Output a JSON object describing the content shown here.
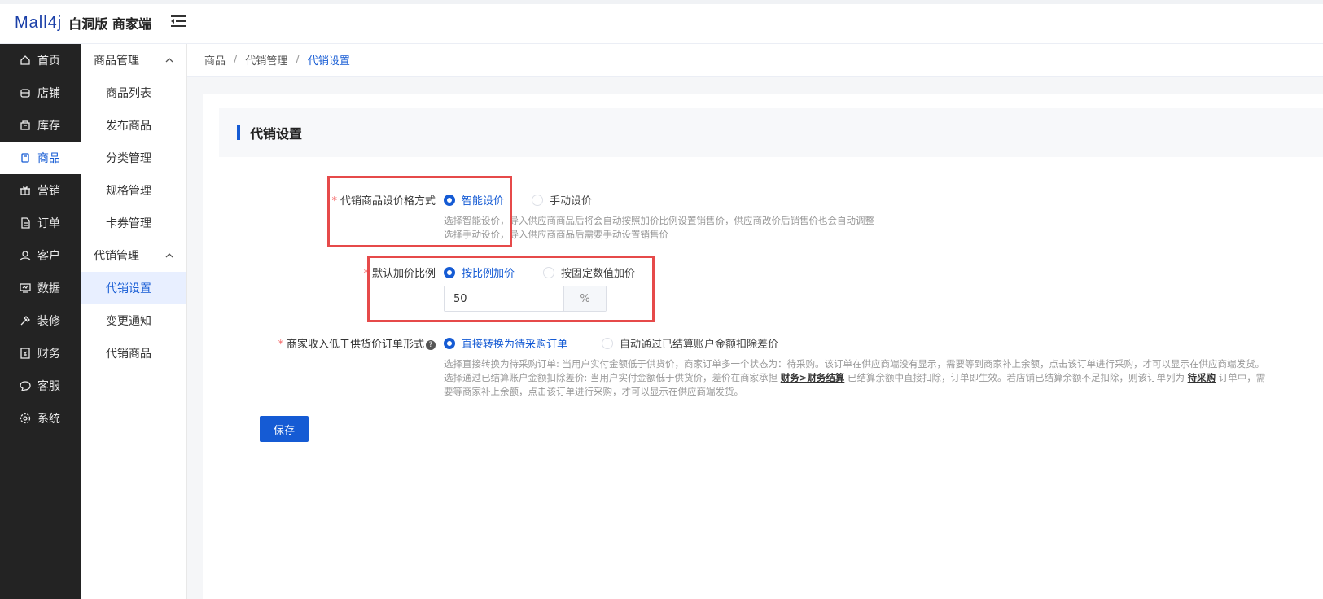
{
  "header": {
    "logo_mark": "Mall4j",
    "logo_text": "白洞版 商家端"
  },
  "sidebar": {
    "items": [
      {
        "label": "首页",
        "icon": "home-icon"
      },
      {
        "label": "店铺",
        "icon": "shop-icon"
      },
      {
        "label": "库存",
        "icon": "inventory-icon"
      },
      {
        "label": "商品",
        "icon": "product-icon"
      },
      {
        "label": "营销",
        "icon": "gift-icon"
      },
      {
        "label": "订单",
        "icon": "order-icon"
      },
      {
        "label": "客户",
        "icon": "customer-icon"
      },
      {
        "label": "数据",
        "icon": "data-icon"
      },
      {
        "label": "装修",
        "icon": "decorate-icon"
      },
      {
        "label": "财务",
        "icon": "finance-icon"
      },
      {
        "label": "客服",
        "icon": "service-icon"
      },
      {
        "label": "系统",
        "icon": "settings-icon"
      }
    ],
    "active_index": 3
  },
  "subnav": {
    "group1": "商品管理",
    "group1_items": [
      "商品列表",
      "发布商品",
      "分类管理",
      "规格管理",
      "卡券管理"
    ],
    "group2": "代销管理",
    "group2_items": [
      "代销设置",
      "变更通知",
      "代销商品"
    ]
  },
  "breadcrumb": [
    "商品",
    "代销管理",
    "代销设置"
  ],
  "card": {
    "title": "代销设置"
  },
  "form": {
    "pricing_label": "代销商品设价格方式",
    "pricing_opt1": "智能设价",
    "pricing_opt2": "手动设价",
    "pricing_hint1": "选择智能设价，导入供应商商品后将会自动按照加价比例设置销售价，供应商改价后销售价也会自动调整",
    "pricing_hint2": "选择手动设价，导入供应商商品后需要手动设置销售价",
    "markup_label": "默认加价比例",
    "markup_opt1": "按比例加价",
    "markup_opt2": "按固定数值加价",
    "markup_value": "50",
    "markup_unit": "%",
    "income_label": "商家收入低于供货价订单形式",
    "income_help": "?",
    "income_opt1": "直接转换为待采购订单",
    "income_opt2": "自动通过已结算账户金额扣除差价",
    "income_hint1": "选择直接转换为待采购订单: 当用户实付金额低于供货价，商家订单多一个状态为：待采购。该订单在供应商端没有显示，需要等到商家补上余额，点击该订单进行采购，才可以显示在供应商端发货。",
    "income_hint2_a": "选择通过已结算账户金额扣除差价: 当用户实付金额低于供货价，差价在商家承担",
    "income_hint2_link1": "财务>财务结算",
    "income_hint2_b": "已结算余额中直接扣除，订单即生效。若店铺已结算余额不足扣除，则该订单列为",
    "income_hint2_link2": "待采购",
    "income_hint2_c": "订单中，需",
    "income_hint3": "要等商家补上余额，点击该订单进行采购，才可以显示在供应商端发货。",
    "save_label": "保存"
  },
  "colors": {
    "primary": "#155bd4",
    "sidebar_bg": "#232323",
    "highlight_box": "#e64a4a"
  }
}
